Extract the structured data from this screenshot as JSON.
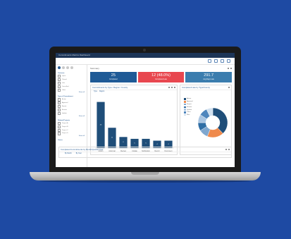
{
  "app": {
    "title": "Commitments Metrics Dashboard"
  },
  "sidebar": {
    "tabs": [
      "filter",
      "list",
      "search",
      "settings"
    ],
    "groups": [
      {
        "title": "Outcome",
        "items": [
          "Open",
          "Closed",
          "Late",
          "Cancelled",
          "Other"
        ],
        "more": "Show all"
      },
      {
        "title": "Type of Commitment",
        "items": [
          "Action",
          "Approval",
          "Report",
          "Review",
          "Update"
        ],
        "more": "Show all"
      },
      {
        "title": "Related Projects",
        "items": [
          "Project A",
          "Project B",
          "Project C",
          "Project D"
        ],
        "more": "Show all"
      },
      {
        "title": "Owner",
        "items": [],
        "more": ""
      }
    ]
  },
  "summary": {
    "title": "Summary",
    "kpis": [
      {
        "value": "25",
        "label": "Completed",
        "color": "#1f5a96"
      },
      {
        "value": "12 (48.0%)",
        "label": "Completed Late",
        "color": "#e8474f"
      },
      {
        "value": "291.7",
        "label": "Avg Days Late",
        "color": "#3b7dae"
      }
    ]
  },
  "bar_panel": {
    "title": "Commitments by Type / Region / County",
    "tabs": [
      "Type",
      "Region"
    ]
  },
  "donut_panel": {
    "title": "Completed Late by Type/County",
    "legend": [
      "Action",
      "Approval",
      "Report",
      "Review",
      "Update",
      "Other",
      "Misc"
    ]
  },
  "bottom_panel": {
    "title": "Completed Commitments by Month/Quarter/Year",
    "tabs": [
      "By Month",
      "By Year"
    ]
  },
  "chart_data": [
    {
      "type": "bar",
      "title": "Commitments by Type / Region / County",
      "categories": [
        "Action",
        "Approval",
        "Review",
        "Update",
        "Notification",
        "Report",
        "Document"
      ],
      "values": [
        25,
        11,
        6,
        5,
        5,
        4,
        4
      ],
      "ylim": [
        0,
        26
      ],
      "grid": false,
      "color": "#1f4e79"
    },
    {
      "type": "pie",
      "title": "Completed Late by Type/County",
      "labels": [
        "Action",
        "Approval",
        "Report",
        "Review",
        "Update",
        "Other",
        "Misc"
      ],
      "values": [
        38,
        18,
        10,
        9,
        9,
        9,
        7
      ],
      "colors": [
        "#1f4e79",
        "#ef8a4c",
        "#7fa7cf",
        "#2f6ea5",
        "#a9c5e2",
        "#4f86bd",
        "#d1e0ef"
      ]
    }
  ]
}
